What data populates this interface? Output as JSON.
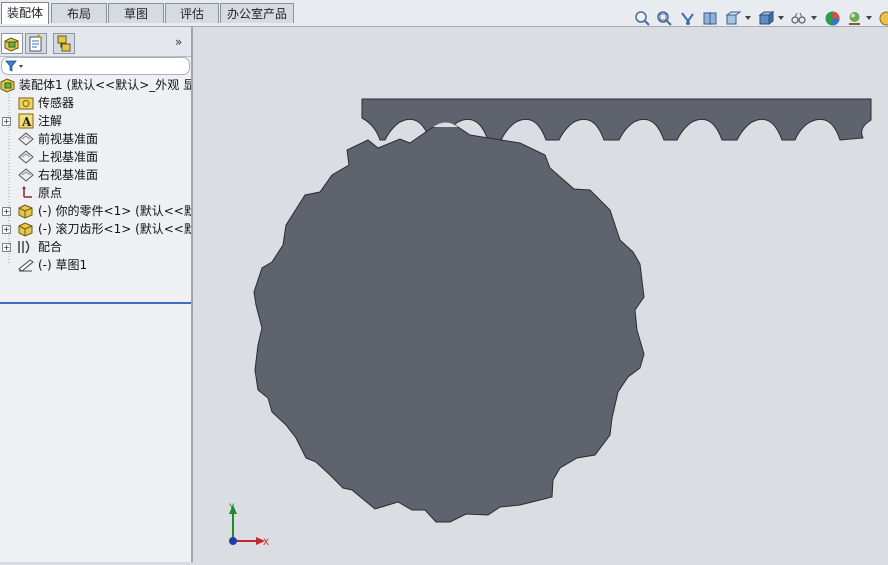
{
  "tabs": [
    {
      "label": "装配体",
      "active": true
    },
    {
      "label": "布局",
      "active": false
    },
    {
      "label": "草图",
      "active": false
    },
    {
      "label": "评估",
      "active": false
    },
    {
      "label": "办公室产品",
      "active": false
    }
  ],
  "view_toolbar": {
    "icons": [
      "zoom-to-fit-icon",
      "zoom-to-area-icon",
      "previous-view-icon",
      "section-view-icon",
      "view-orientation-icon",
      "display-style-icon",
      "hide-show-items-icon",
      "edit-appearance-icon",
      "apply-scene-icon",
      "view-settings-icon"
    ]
  },
  "feature_manager": {
    "pane_tabs": [
      "feature-manager-tab",
      "property-manager-tab",
      "configuration-manager-tab"
    ],
    "expand_label": "»",
    "tree": [
      {
        "label": "装配体1  (默认<<默认>_外观 显",
        "icon": "assembly-icon",
        "expander": "",
        "level": 0
      },
      {
        "label": "传感器",
        "icon": "sensor-icon",
        "expander": "",
        "level": 1
      },
      {
        "label": "注解",
        "icon": "annotation-icon",
        "expander": "+",
        "level": 1
      },
      {
        "label": "前视基准面",
        "icon": "plane-icon",
        "expander": "",
        "level": 1
      },
      {
        "label": "上视基准面",
        "icon": "plane-icon",
        "expander": "",
        "level": 1
      },
      {
        "label": "右视基准面",
        "icon": "plane-icon",
        "expander": "",
        "level": 1
      },
      {
        "label": "原点",
        "icon": "origin-icon",
        "expander": "",
        "level": 1
      },
      {
        "label": "(-) 你的零件<1> (默认<<默认",
        "icon": "part-icon",
        "expander": "+",
        "level": 1
      },
      {
        "label": "(-) 滚刀齿形<1> (默认<<默认",
        "icon": "part-icon",
        "expander": "+",
        "level": 1
      },
      {
        "label": "配合",
        "icon": "mates-icon",
        "expander": "+",
        "level": 1
      },
      {
        "label": "(-) 草图1",
        "icon": "sketch-icon",
        "expander": "",
        "level": 1
      }
    ]
  },
  "triad": {
    "y_label": "Y",
    "x_label": "X"
  },
  "colors": {
    "model": "#5f636e",
    "viewport": "#dadde2",
    "accent": "#3c6fb7"
  }
}
